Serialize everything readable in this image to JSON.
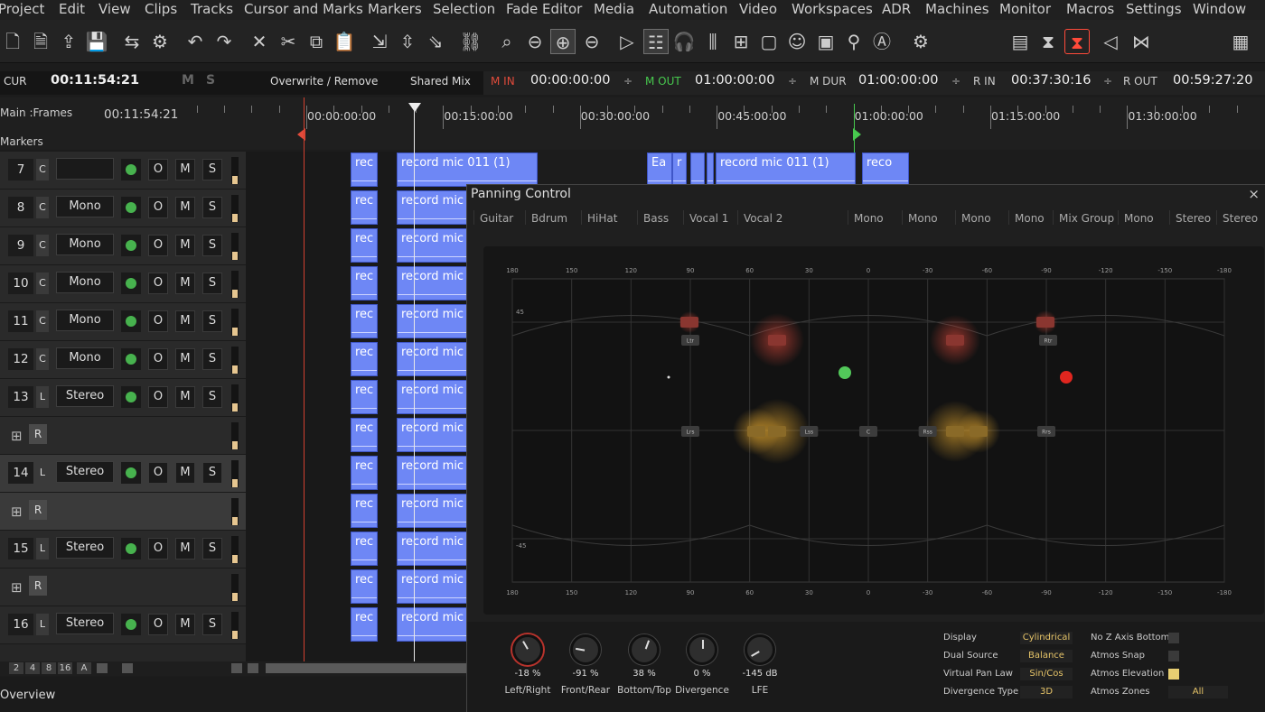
{
  "menu": [
    "Project",
    "Edit",
    "View",
    "Clips",
    "Tracks",
    "Cursor and Marks",
    "Markers",
    "Selection",
    "Fade Editor",
    "Media",
    "Automation",
    "Video",
    "Workspaces",
    "ADR",
    "Machines",
    "Monitor",
    "Macros",
    "Settings",
    "Window"
  ],
  "toolbar": {
    "icons": [
      "new-file-icon",
      "new-doc-icon",
      "open-folder-icon",
      "save-icon",
      "import-icon",
      "settings-tool-icon",
      "undo-icon",
      "redo-icon",
      "cut-x-icon",
      "scissors-icon",
      "copy-icon",
      "paste-icon",
      "trim-icon",
      "split-icon",
      "glue-icon",
      "link-icon",
      "zoom-icon",
      "zoom-out-icon",
      "zoom-fit-icon",
      "zoom-in-icon",
      "play-icon",
      "mixer-icon",
      "headphones-icon",
      "meters-icon",
      "grid-icon",
      "crop-icon",
      "media-icon",
      "folder-icon",
      "search-media-icon",
      "automation-a-icon",
      "gear-icon"
    ],
    "right_icons": [
      "layout-icon",
      "sliders-icon",
      "panner-icon",
      "speaker-icon",
      "mute-icon",
      "meter-bars-icon"
    ]
  },
  "timecode": {
    "cur_label": "CUR",
    "cur_value": "00:11:54:21",
    "m": "M",
    "s": "S",
    "mode": "Overwrite / Remove",
    "mix": "Shared Mix",
    "min_label": "M IN",
    "min_value": "00:00:00:00",
    "mout_label": "M OUT",
    "mout_value": "01:00:00:00",
    "mdur_label": "M DUR",
    "mdur_value": "01:00:00:00",
    "rin_label": "R IN",
    "rin_value": "00:37:30:16",
    "rout_label": "R OUT",
    "rout_value": "00:59:27:20",
    "spin": "÷"
  },
  "ruler": {
    "main_label": "Main :Frames",
    "main_value": "00:11:54:21",
    "markers_label": "Markers",
    "times": [
      "00:00:00:00",
      "00:15:00:00",
      "00:30:00:00",
      "00:45:00:00",
      "01:00:00:00",
      "01:15:00:00",
      "01:30:00:00"
    ]
  },
  "tracks": [
    {
      "num": "7",
      "cb": "C",
      "type": ""
    },
    {
      "num": "8",
      "cb": "C",
      "type": "Mono"
    },
    {
      "num": "9",
      "cb": "C",
      "type": "Mono"
    },
    {
      "num": "10",
      "cb": "C",
      "type": "Mono"
    },
    {
      "num": "11",
      "cb": "C",
      "type": "Mono"
    },
    {
      "num": "12",
      "cb": "C",
      "type": "Mono"
    },
    {
      "num": "13",
      "cb": "L",
      "type": "Stereo"
    },
    {
      "sub": true,
      "r": "R"
    },
    {
      "num": "14",
      "cb": "L",
      "type": "Stereo",
      "sel": true
    },
    {
      "sub": true,
      "r": "R",
      "sel": true
    },
    {
      "num": "15",
      "cb": "L",
      "type": "Stereo"
    },
    {
      "sub": true,
      "r": "R"
    },
    {
      "num": "16",
      "cb": "L",
      "type": "Stereo"
    }
  ],
  "track_buttons": {
    "o": "O",
    "m": "M",
    "s": "S"
  },
  "clips": {
    "rec": "rec",
    "rec_mic": "record mic",
    "first": "record mic 011 (1)",
    "ea": "Ea",
    "r": "r",
    "mid": "record mic 011 (1)",
    "reco": "reco"
  },
  "bottom": {
    "zoom": [
      "2",
      "4",
      "8",
      "16",
      "A"
    ],
    "overview": "Overview"
  },
  "panning": {
    "title": "Panning Control",
    "close": "×",
    "channels": [
      "Guitar",
      "Bdrum",
      "HiHat",
      "Bass",
      "Vocal 1",
      "Vocal 2",
      "Mono",
      "Mono",
      "Mono",
      "Mono",
      "Mix Group",
      "Mono",
      "Stereo",
      "Stereo"
    ],
    "top_axis": [
      "180",
      "150",
      "120",
      "90",
      "60",
      "30",
      "0",
      "-30",
      "-60",
      "-90",
      "-120",
      "-150",
      "-180"
    ],
    "elev": [
      "45",
      "-45"
    ],
    "speakers_top": [
      "Ltr",
      "Rtr"
    ],
    "speakers_mid": [
      "Lrs",
      "Lss",
      "C",
      "Rss",
      "Rrs"
    ],
    "knobs": [
      {
        "value": "-18 %",
        "label": "Left/Right"
      },
      {
        "value": "-91 %",
        "label": "Front/Rear"
      },
      {
        "value": "38 %",
        "label": "Bottom/Top"
      },
      {
        "value": "0 %",
        "label": "Divergence"
      },
      {
        "value": "-145 dB",
        "label": "LFE"
      }
    ],
    "settings": [
      {
        "label": "Display",
        "value": "Cylindrical"
      },
      {
        "label": "Dual Source",
        "value": "Balance"
      },
      {
        "label": "Virtual Pan Law",
        "value": "Sin/Cos"
      },
      {
        "label": "Divergence Type",
        "value": "3D"
      }
    ],
    "options": [
      {
        "label": "No Z Axis Bottom"
      },
      {
        "label": "Atmos Snap"
      },
      {
        "label": "Atmos Elevation"
      },
      {
        "label": "Atmos Zones",
        "value": "All"
      }
    ]
  },
  "colors": {
    "accent": "#6e87f5",
    "green": "#47b24e",
    "red": "#e0261f",
    "amber": "#e6c468"
  }
}
